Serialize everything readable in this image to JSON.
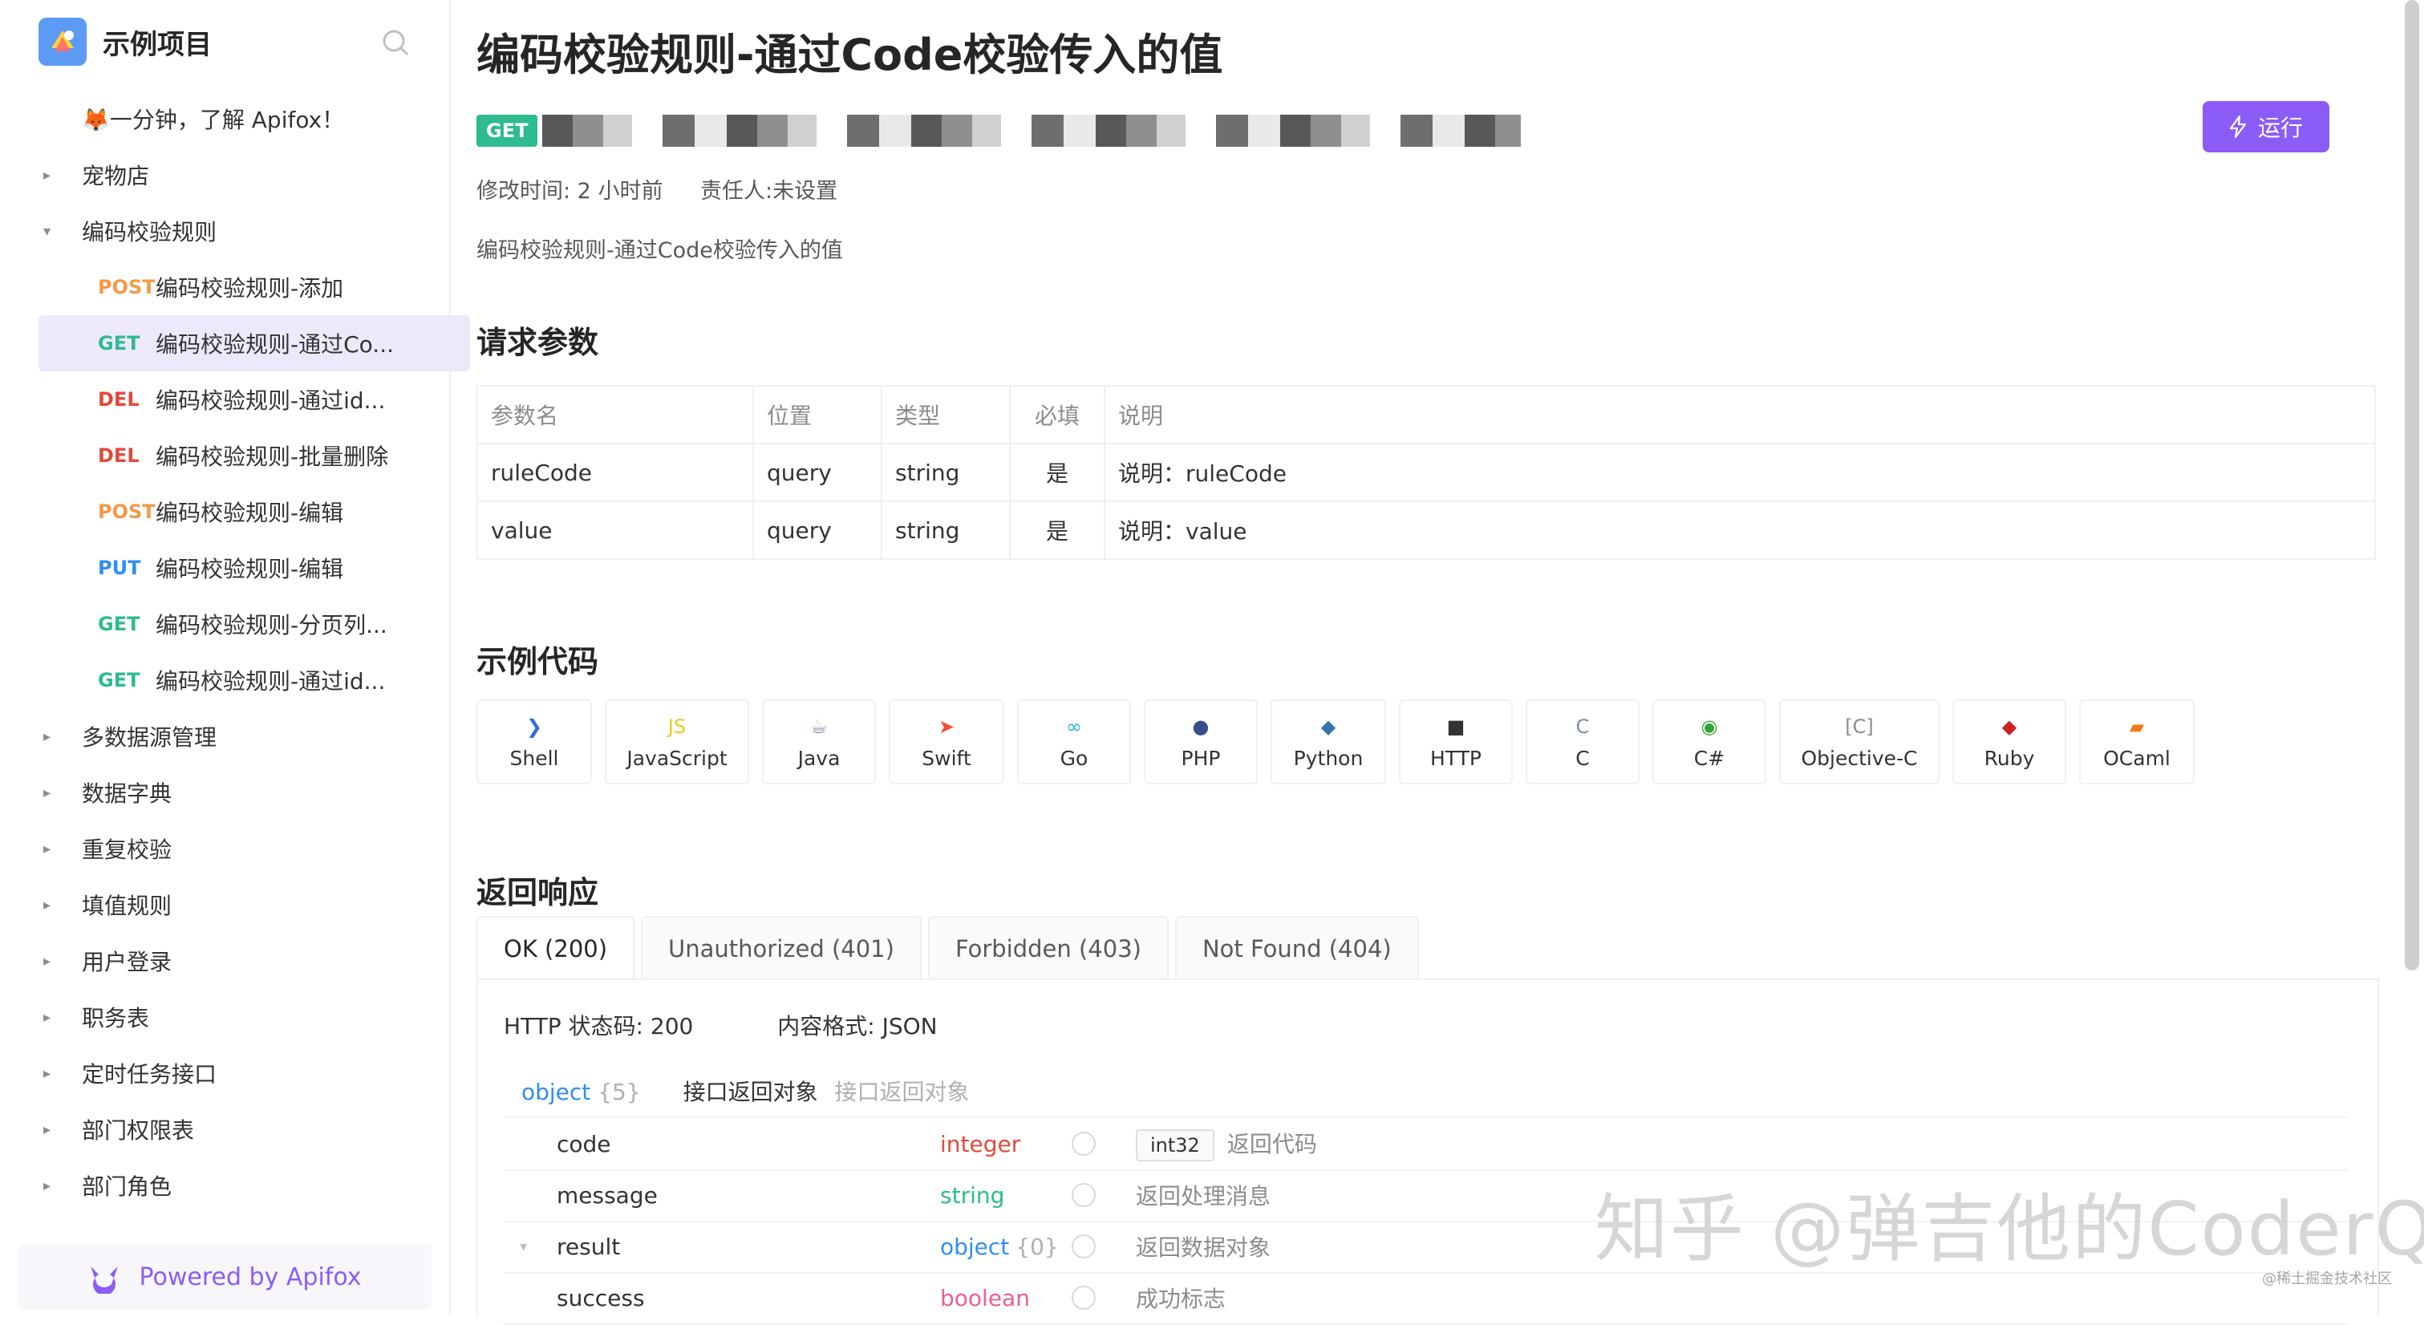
{
  "sidebar": {
    "project_title": "示例项目",
    "items": [
      {
        "kind": "leaf",
        "method": "",
        "label": "🦊一分钟，了解 Apifox！"
      },
      {
        "kind": "folder",
        "caret": "▸",
        "label": "宠物店"
      },
      {
        "kind": "folder",
        "caret": "▾",
        "label": "编码校验规则"
      },
      {
        "kind": "child",
        "method": "POST",
        "label": "编码校验规则-添加"
      },
      {
        "kind": "child",
        "method": "GET",
        "label": "编码校验规则-通过Co...",
        "selected": true
      },
      {
        "kind": "child",
        "method": "DEL",
        "label": "编码校验规则-通过id..."
      },
      {
        "kind": "child",
        "method": "DEL",
        "label": "编码校验规则-批量删除"
      },
      {
        "kind": "child",
        "method": "POST",
        "label": "编码校验规则-编辑"
      },
      {
        "kind": "child",
        "method": "PUT",
        "label": "编码校验规则-编辑"
      },
      {
        "kind": "child",
        "method": "GET",
        "label": "编码校验规则-分页列..."
      },
      {
        "kind": "child",
        "method": "GET",
        "label": "编码校验规则-通过id..."
      },
      {
        "kind": "folder",
        "caret": "▸",
        "label": "多数据源管理"
      },
      {
        "kind": "folder",
        "caret": "▸",
        "label": "数据字典"
      },
      {
        "kind": "folder",
        "caret": "▸",
        "label": "重复校验"
      },
      {
        "kind": "folder",
        "caret": "▸",
        "label": "填值规则"
      },
      {
        "kind": "folder",
        "caret": "▸",
        "label": "用户登录"
      },
      {
        "kind": "folder",
        "caret": "▸",
        "label": "职务表"
      },
      {
        "kind": "folder",
        "caret": "▸",
        "label": "定时任务接口"
      },
      {
        "kind": "folder",
        "caret": "▸",
        "label": "部门权限表"
      },
      {
        "kind": "folder",
        "caret": "▸",
        "label": "部门角色"
      }
    ],
    "powered_by": "Powered by Apifox"
  },
  "main": {
    "title": "编码校验规则-通过Code校验传入的值",
    "method_badge": "GET",
    "run_label": "运行",
    "modified": "修改时间: 2 小时前",
    "owner": "责任人:未设置",
    "description": "编码校验规则-通过Code校验传入的值",
    "params_title": "请求参数",
    "params_headers": [
      "参数名",
      "位置",
      "类型",
      "必填",
      "说明"
    ],
    "params_rows": [
      [
        "ruleCode",
        "query",
        "string",
        "是",
        "说明：ruleCode"
      ],
      [
        "value",
        "query",
        "string",
        "是",
        "说明：value"
      ]
    ],
    "code_title": "示例代码",
    "languages": [
      {
        "name": "Shell",
        "icon": "terminal-icon",
        "glyph": "❯",
        "color": "#2f6fd6"
      },
      {
        "name": "JavaScript",
        "icon": "javascript-icon",
        "glyph": "JS",
        "color": "#e8c820"
      },
      {
        "name": "Java",
        "icon": "java-icon",
        "glyph": "☕",
        "color": "#7a8ea8"
      },
      {
        "name": "Swift",
        "icon": "swift-icon",
        "glyph": "➤",
        "color": "#f05138"
      },
      {
        "name": "Go",
        "icon": "go-icon",
        "glyph": "∞",
        "color": "#2db1d6"
      },
      {
        "name": "PHP",
        "icon": "php-icon",
        "glyph": "●",
        "color": "#3b4c8c"
      },
      {
        "name": "Python",
        "icon": "python-icon",
        "glyph": "◆",
        "color": "#3776ab"
      },
      {
        "name": "HTTP",
        "icon": "http-icon",
        "glyph": "■",
        "color": "#333333"
      },
      {
        "name": "C",
        "icon": "c-icon",
        "glyph": "C",
        "color": "#7a8ea8"
      },
      {
        "name": "C#",
        "icon": "csharp-icon",
        "glyph": "◉",
        "color": "#35a33a"
      },
      {
        "name": "Objective-C",
        "icon": "objective-c-icon",
        "glyph": "[C]",
        "color": "#8c8c8c"
      },
      {
        "name": "Ruby",
        "icon": "ruby-icon",
        "glyph": "◆",
        "color": "#cc2222"
      },
      {
        "name": "OCaml",
        "icon": "ocaml-icon",
        "glyph": "▰",
        "color": "#ee7a1a"
      }
    ],
    "response_title": "返回响应",
    "response_tabs": [
      "OK (200)",
      "Unauthorized (401)",
      "Forbidden (403)",
      "Not Found (404)"
    ],
    "http_status": "HTTP 状态码: 200",
    "content_format": "内容格式: JSON",
    "schema_root": {
      "type": "object",
      "count": "{5}",
      "name": "接口返回对象",
      "desc": "接口返回对象"
    },
    "schema_fields": [
      {
        "name": "code",
        "type": "integer",
        "type_class": "t-int",
        "format": "int32",
        "desc": "返回代码"
      },
      {
        "name": "message",
        "type": "string",
        "type_class": "t-str",
        "format": "",
        "desc": "返回处理消息"
      },
      {
        "name": "result",
        "type": "object",
        "type_class": "t-obj",
        "count": "{0}",
        "format": "",
        "desc": "返回数据对象",
        "expandable": true
      },
      {
        "name": "success",
        "type": "boolean",
        "type_class": "t-bool",
        "format": "",
        "desc": "成功标志"
      }
    ]
  },
  "watermark": "知乎 @弹吉他的CoderQ",
  "watermark_small": "@稀土掘金技术社区"
}
